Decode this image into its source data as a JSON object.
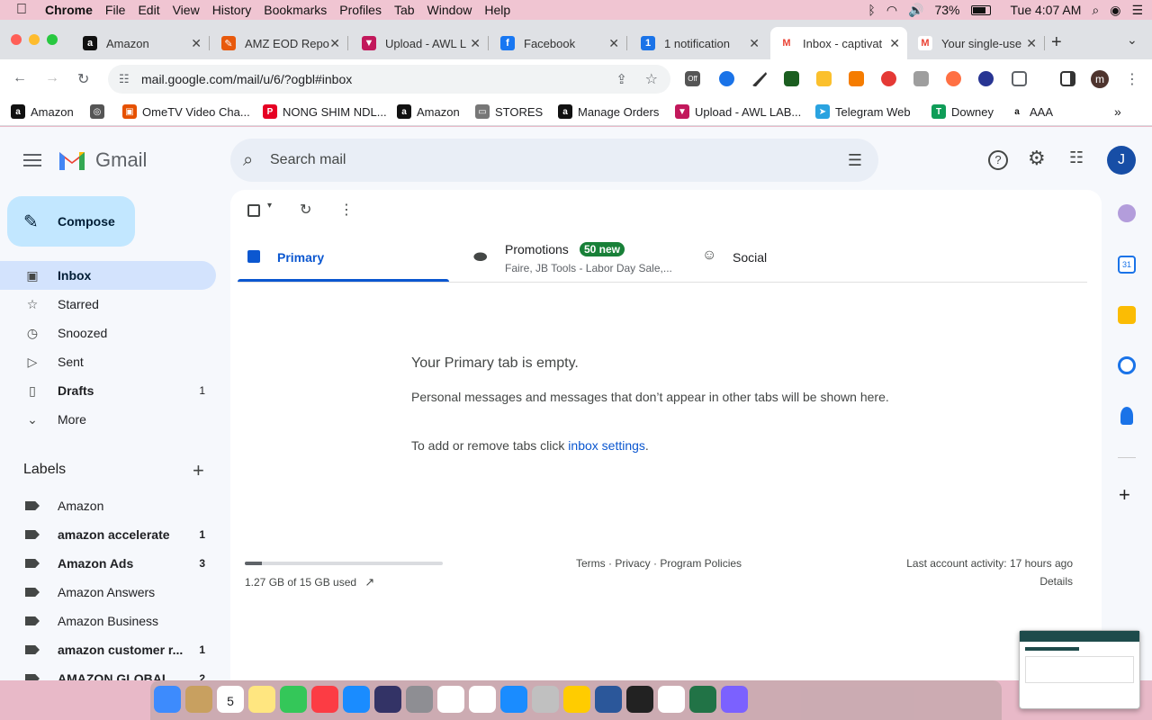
{
  "menubar": {
    "app": "Chrome",
    "items": [
      "File",
      "Edit",
      "View",
      "History",
      "Bookmarks",
      "Profiles",
      "Tab",
      "Window",
      "Help"
    ],
    "battery": "73%",
    "clock": "Tue 4:07 AM",
    "battery_level": 0.73
  },
  "tabs": [
    {
      "title": "Amazon",
      "icon": "amazon-icon",
      "color": "#111111",
      "glyph": "a"
    },
    {
      "title": "AMZ EOD Repo",
      "icon": "amz-eod-icon",
      "color": "#e8590c",
      "glyph": "✎"
    },
    {
      "title": "Upload - AWL L",
      "icon": "awl-icon",
      "color": "#c2185b",
      "glyph": "▼"
    },
    {
      "title": "Facebook",
      "icon": "facebook-icon",
      "color": "#1877f2",
      "glyph": "f"
    },
    {
      "title": "1 notification",
      "icon": "notification-icon",
      "color": "#1a73e8",
      "glyph": "1"
    },
    {
      "title": "Inbox - captivat",
      "icon": "gmail-icon",
      "color": "#ffffff",
      "glyph": "M"
    },
    {
      "title": "Your single-use",
      "icon": "gmail-icon",
      "color": "#ffffff",
      "glyph": "M"
    }
  ],
  "toolbar": {
    "url": "mail.google.com/mail/u/6/?ogbl#inbox",
    "off_badge": "Off",
    "profile_letter": "m"
  },
  "bookmarks": [
    {
      "label": "Amazon",
      "color": "#111111",
      "glyph": "a"
    },
    {
      "label": "",
      "color": "#555555",
      "glyph": "◎"
    },
    {
      "label": "OmeTV Video Cha...",
      "color": "#e65100",
      "glyph": "▣"
    },
    {
      "label": "NONG SHIM NDL...",
      "color": "#e60023",
      "glyph": "P"
    },
    {
      "label": "Amazon",
      "color": "#111111",
      "glyph": "a"
    },
    {
      "label": "STORES",
      "color": "#777777",
      "glyph": "▭"
    },
    {
      "label": "Manage Orders",
      "color": "#111111",
      "glyph": "a"
    },
    {
      "label": "Upload - AWL LAB...",
      "color": "#c2185b",
      "glyph": "▼"
    },
    {
      "label": "Telegram Web",
      "color": "#2aa3e0",
      "glyph": "➤"
    },
    {
      "label": "Downey",
      "color": "#0f9d58",
      "glyph": "T"
    },
    {
      "label": "AAA",
      "color": "#ffffff",
      "glyph": "a"
    }
  ],
  "gmail": {
    "brand": "Gmail",
    "search_placeholder": "Search mail",
    "compose": "Compose",
    "avatar_letter": "J",
    "nav": [
      {
        "label": "Inbox",
        "icon": "inbox-icon",
        "count": "",
        "active": true
      },
      {
        "label": "Starred",
        "icon": "star-icon",
        "count": "",
        "active": false
      },
      {
        "label": "Snoozed",
        "icon": "clock-icon",
        "count": "",
        "active": false
      },
      {
        "label": "Sent",
        "icon": "send-icon",
        "count": "",
        "active": false
      },
      {
        "label": "Drafts",
        "icon": "draft-icon",
        "count": "1",
        "active": false,
        "bold": true
      },
      {
        "label": "More",
        "icon": "chevron-down-icon",
        "count": "",
        "active": false
      }
    ],
    "labels_title": "Labels",
    "labels": [
      {
        "label": "Amazon",
        "count": "",
        "bold": false
      },
      {
        "label": "amazon accelerate",
        "count": "1",
        "bold": true
      },
      {
        "label": "Amazon Ads",
        "count": "3",
        "bold": true
      },
      {
        "label": "Amazon Answers",
        "count": "",
        "bold": false
      },
      {
        "label": "Amazon Business",
        "count": "",
        "bold": false
      },
      {
        "label": "amazon customer r...",
        "count": "1",
        "bold": true
      },
      {
        "label": "AMAZON GLOBAL",
        "count": "2",
        "bold": true
      }
    ],
    "tabs": [
      {
        "label": "Primary",
        "icon": "inbox-tab-icon",
        "active": true
      },
      {
        "label": "Promotions",
        "icon": "tag-icon",
        "badge": "50 new",
        "sub": "Faire, JB Tools - Labor Day Sale,..."
      },
      {
        "label": "Social",
        "icon": "people-icon"
      }
    ],
    "empty_title": "Your Primary tab is empty.",
    "empty_body": "Personal messages and messages that don’t appear in other tabs will be shown here.",
    "empty_link_prefix": "To add or remove tabs click ",
    "empty_link": "inbox settings",
    "empty_link_suffix": ".",
    "storage_text": "1.27 GB of 15 GB used",
    "storage_fraction": 0.085,
    "footer_links": "Terms · Privacy · Program Policies",
    "last_activity": "Last account activity: 17 hours ago",
    "details": "Details"
  },
  "dock": {
    "calendar_day": "5",
    "calendar_month": "SEP",
    "apps": [
      "finder",
      "notes",
      "calendar",
      "stickies",
      "facetime",
      "music",
      "app-store",
      "siri",
      "system-prefs",
      "chrome",
      "reminders",
      "safari",
      "launchpad",
      "photos",
      "word",
      "terminal",
      "activity-monitor",
      "excel",
      "messenger"
    ]
  }
}
